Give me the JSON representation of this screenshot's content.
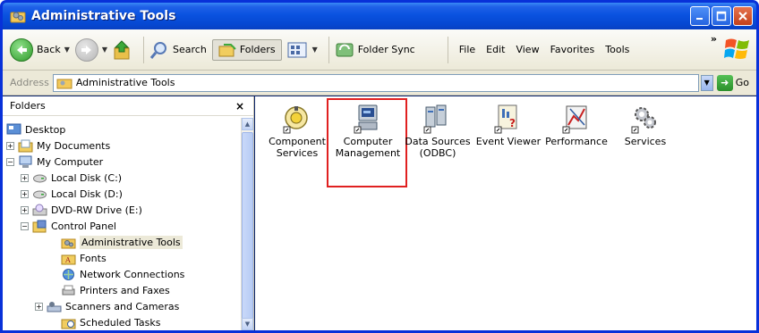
{
  "window": {
    "title": "Administrative Tools"
  },
  "toolbar": {
    "back_label": "Back",
    "search_label": "Search",
    "folders_label": "Folders",
    "folder_sync_label": "Folder Sync",
    "menu": [
      "File",
      "Edit",
      "View",
      "Favorites",
      "Tools"
    ],
    "overflow": "»"
  },
  "address": {
    "label": "Address",
    "value": "Administrative Tools",
    "go_label": "Go"
  },
  "folders_pane": {
    "title": "Folders",
    "close_glyph": "×",
    "tree": [
      {
        "label": "Desktop",
        "icon": "desktop-icon",
        "expander": ""
      },
      {
        "label": "My Documents",
        "icon": "my-documents-icon",
        "expander": "+"
      },
      {
        "label": "My Computer",
        "icon": "my-computer-icon",
        "expander": "−"
      },
      {
        "label": "Local Disk (C:)",
        "icon": "local-disk-icon",
        "expander": "+"
      },
      {
        "label": "Local Disk (D:)",
        "icon": "local-disk-icon",
        "expander": "+"
      },
      {
        "label": "DVD-RW Drive (E:)",
        "icon": "dvd-drive-icon",
        "expander": "+"
      },
      {
        "label": "Control Panel",
        "icon": "control-panel-icon",
        "expander": "−"
      },
      {
        "label": "Administrative Tools",
        "icon": "administrative-tools-icon",
        "expander": "",
        "selected": true
      },
      {
        "label": "Fonts",
        "icon": "fonts-folder-icon",
        "expander": ""
      },
      {
        "label": "Network Connections",
        "icon": "network-connections-icon",
        "expander": ""
      },
      {
        "label": "Printers and Faxes",
        "icon": "printers-icon",
        "expander": ""
      },
      {
        "label": "Scanners and Cameras",
        "icon": "scanners-icon",
        "expander": "+"
      },
      {
        "label": "Scheduled Tasks",
        "icon": "scheduled-tasks-icon",
        "expander": ""
      }
    ]
  },
  "content": {
    "items": [
      {
        "line1": "Component",
        "line2": "Services",
        "icon": "component-services-icon"
      },
      {
        "line1": "Computer",
        "line2": "Management",
        "icon": "computer-management-icon"
      },
      {
        "line1": "Data Sources",
        "line2": "(ODBC)",
        "icon": "data-sources-icon"
      },
      {
        "line1": "Event Viewer",
        "line2": "",
        "icon": "event-viewer-icon"
      },
      {
        "line1": "Performance",
        "line2": "",
        "icon": "performance-icon"
      },
      {
        "line1": "Services",
        "line2": "",
        "icon": "services-icon"
      }
    ]
  }
}
